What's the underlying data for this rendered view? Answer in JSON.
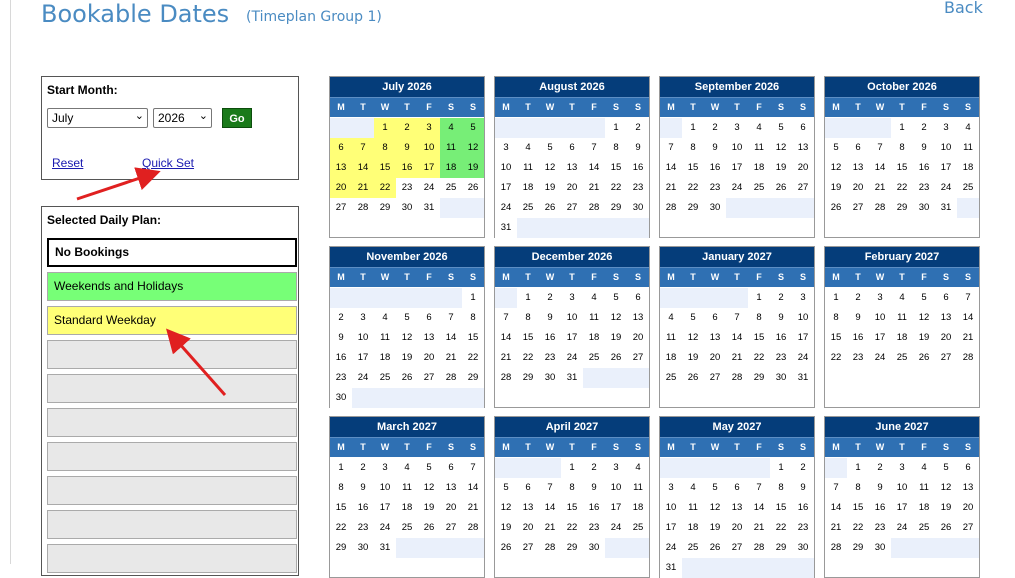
{
  "header": {
    "title": "Bookable Dates",
    "subtitle": "(Timeplan Group 1)",
    "back": "Back"
  },
  "start_month": {
    "label": "Start Month:",
    "month": "July",
    "year": "2026",
    "go": "Go",
    "reset": "Reset",
    "quick_set": "Quick Set"
  },
  "daily_plan": {
    "label": "Selected Daily Plan:",
    "plans": [
      {
        "label": "No Bookings",
        "color": "#ffffff"
      },
      {
        "label": "Weekends and Holidays",
        "color": "#77ff77"
      },
      {
        "label": "Standard Weekday",
        "color": "#ffff77"
      },
      {
        "label": ""
      },
      {
        "label": ""
      },
      {
        "label": ""
      },
      {
        "label": ""
      },
      {
        "label": ""
      },
      {
        "label": ""
      },
      {
        "label": ""
      }
    ]
  },
  "colors": {
    "header": "#053d7a",
    "dow": "#2f70b3",
    "weekday": "#ffff77",
    "weekend": "#77ee77"
  },
  "weekdays": [
    "M",
    "T",
    "W",
    "T",
    "F",
    "S",
    "S"
  ],
  "months": [
    {
      "title": "July 2026",
      "offset": 2,
      "days": 31,
      "marks": {
        "1": "y",
        "2": "y",
        "3": "y",
        "4": "g",
        "5": "g",
        "6": "y",
        "7": "y",
        "8": "y",
        "9": "y",
        "10": "y",
        "11": "g",
        "12": "g",
        "13": "y",
        "14": "y",
        "15": "y",
        "16": "y",
        "17": "y",
        "18": "g",
        "19": "g",
        "20": "y",
        "21": "y",
        "22": "y"
      }
    },
    {
      "title": "August 2026",
      "offset": 5,
      "days": 31,
      "marks": {}
    },
    {
      "title": "September 2026",
      "offset": 1,
      "days": 30,
      "marks": {}
    },
    {
      "title": "October 2026",
      "offset": 3,
      "days": 31,
      "marks": {}
    },
    {
      "title": "November 2026",
      "offset": 6,
      "days": 30,
      "marks": {}
    },
    {
      "title": "December 2026",
      "offset": 1,
      "days": 31,
      "marks": {}
    },
    {
      "title": "January 2027",
      "offset": 4,
      "days": 31,
      "marks": {}
    },
    {
      "title": "February 2027",
      "offset": 0,
      "days": 28,
      "marks": {}
    },
    {
      "title": "March 2027",
      "offset": 0,
      "days": 31,
      "marks": {}
    },
    {
      "title": "April 2027",
      "offset": 3,
      "days": 30,
      "marks": {}
    },
    {
      "title": "May 2027",
      "offset": 5,
      "days": 31,
      "marks": {}
    },
    {
      "title": "June 2027",
      "offset": 1,
      "days": 30,
      "marks": {}
    }
  ]
}
